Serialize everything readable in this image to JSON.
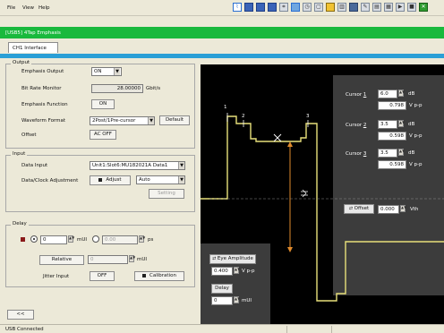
{
  "menu": [
    "File",
    "View",
    "Help"
  ],
  "toolbar": {
    "icons": [
      "waveform-icon",
      "view-list-icon",
      "grid-icon",
      "table-icon",
      "chart-icon",
      "waveform-blue-icon",
      "history-icon",
      "window-icon",
      "tool-icon",
      "bar-chart-icon",
      "edit-icon",
      "brush-icon",
      "print-icon",
      "dashboard-icon",
      "play-icon",
      "stop-icon",
      "exit-icon"
    ]
  },
  "title_bar": "[USB5] 4Tap Emphasis",
  "tab": "CH1 Interface",
  "output": {
    "group_title": "Output",
    "emphasis_output_label": "Emphasis Output",
    "emphasis_output_value": "ON",
    "bit_rate_label": "Bit Rate Monitor",
    "bit_rate_value": "28.00000",
    "bit_rate_unit": "Gbit/s",
    "emphasis_function_label": "Emphasis Function",
    "emphasis_function_value": "ON",
    "waveform_format_label": "Waveform Format",
    "waveform_format_value": "2Post/1Pre-cursor",
    "default_button": "Default",
    "offset_label": "Offset",
    "offset_value": "AC OFF"
  },
  "input": {
    "group_title": "Input",
    "data_input_label": "Data Input",
    "data_input_value": "Unit1:Slot6:MU182021A Data1",
    "adjust_label": "Data/Clock Adjustment",
    "adjust_button": "Adjust",
    "auto_value": "Auto",
    "setting_button": "Setting"
  },
  "delay": {
    "group_title": "Delay",
    "mui_value": "0",
    "mui_unit": "mUI",
    "ps_value": "0.00",
    "ps_unit": "ps",
    "relative_button": "Relative",
    "relative_value": "0",
    "relative_unit": "mUI",
    "jitter_label": "Jitter Input",
    "jitter_value": "OFF",
    "calibration_button": "Calibration"
  },
  "collapse_button": "<<",
  "status_bar": "USB Connected",
  "waveform": {
    "markers": [
      "1",
      "2",
      "3"
    ],
    "cursors": [
      {
        "label_prefix": "Cursor ",
        "index": "1",
        "value": "6.0",
        "unit": "dB",
        "vpp": "0.798",
        "vpp_unit": "V p-p"
      },
      {
        "label_prefix": "Cursor ",
        "index": "2",
        "value": "3.5",
        "unit": "dB",
        "vpp": "0.598",
        "vpp_unit": "V p-p"
      },
      {
        "label_prefix": "Cursor ",
        "index": "3",
        "value": "3.5",
        "unit": "dB",
        "vpp": "0.598",
        "vpp_unit": "V p-p"
      }
    ],
    "offset_label": "Offset",
    "offset_value": "0.000",
    "offset_unit": "Vth",
    "eye_amplitude_label": "Eye Amplitude",
    "eye_amplitude_value": "0.400",
    "eye_amplitude_unit": "V p-p",
    "delay_label": "Delay",
    "delay_value": "0",
    "delay_unit": "mUI"
  },
  "colors": {
    "title_bar": "#19b93d",
    "waveform_bg": "#000000",
    "waveform_line": "#e8e07a",
    "cursor_panel": "#3c3c3c",
    "arrow": "#e08a2c"
  }
}
